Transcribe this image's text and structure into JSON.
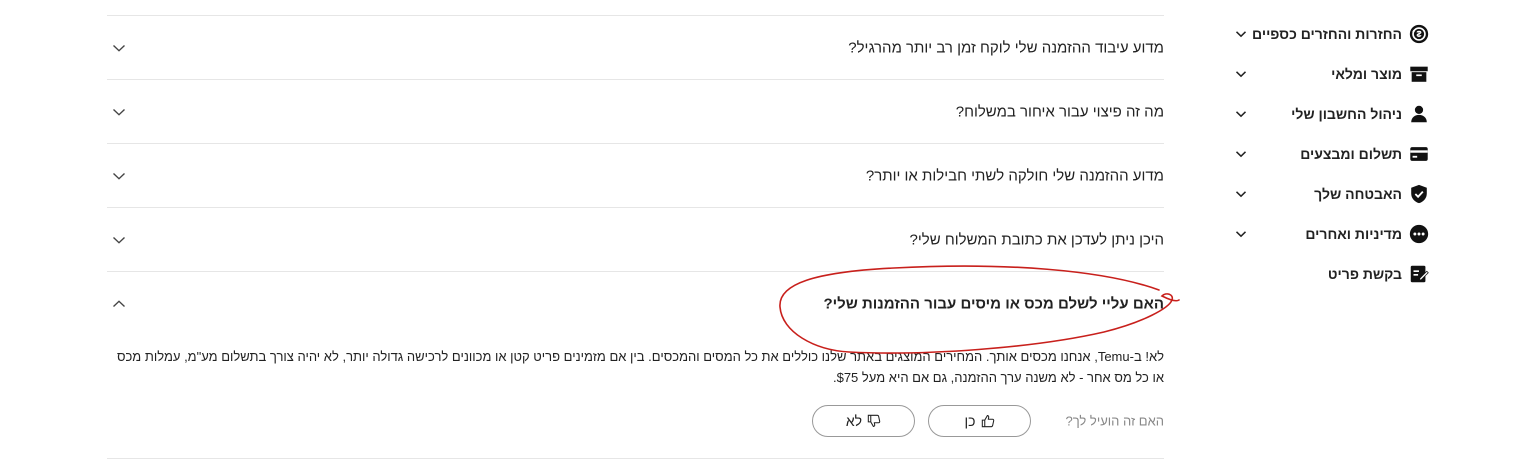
{
  "sidebar": {
    "items": [
      {
        "label": "החזרות והחזרים כספיים",
        "icon": "refund-icon",
        "chevron": true
      },
      {
        "label": "מוצר ומלאי",
        "icon": "archive-box-icon",
        "chevron": true
      },
      {
        "label": "ניהול החשבון שלי",
        "icon": "user-icon",
        "chevron": true
      },
      {
        "label": "תשלום ומבצעים",
        "icon": "credit-card-icon",
        "chevron": true
      },
      {
        "label": "האבטחה שלך",
        "icon": "shield-check-icon",
        "chevron": true
      },
      {
        "label": "מדיניות ואחרים",
        "icon": "more-dots-icon",
        "chevron": true
      },
      {
        "label": "בקשת פריט",
        "icon": "edit-note-icon",
        "chevron": false
      }
    ]
  },
  "faq": {
    "questions": [
      {
        "q": "מדוע עיבוד ההזמנה שלי לוקח זמן רב יותר מהרגיל?",
        "expanded": false
      },
      {
        "q": "מה זה פיצוי עבור איחור במשלוח?",
        "expanded": false
      },
      {
        "q": "מדוע ההזמנה שלי חולקה לשתי חבילות או יותר?",
        "expanded": false
      },
      {
        "q": "היכן ניתן לעדכן את כתובת המשלוח שלי?",
        "expanded": false
      },
      {
        "q": "האם עליי לשלם מכס או מיסים עבור ההזמנות שלי?",
        "expanded": true
      }
    ],
    "answer": "לא! ב-Temu, אנחנו מכסים אותך. המחירים המוצגים באתר שלנו כוללים את כל המסים והמכסים. בין אם מזמינים פריט קטן או מכוונים לרכישה גדולה יותר, לא יהיה צורך בתשלום מע\"מ, עמלות מכס או כל מס אחר - לא משנה ערך ההזמנה, גם אם היא מעל $75.",
    "helpful": {
      "question": "האם זה הועיל לך?",
      "yes_label": "כן",
      "no_label": "לא"
    }
  },
  "colors": {
    "text": "#222222",
    "muted": "#888888",
    "divider": "#e6e6e6",
    "annotation": "#c8201c"
  }
}
